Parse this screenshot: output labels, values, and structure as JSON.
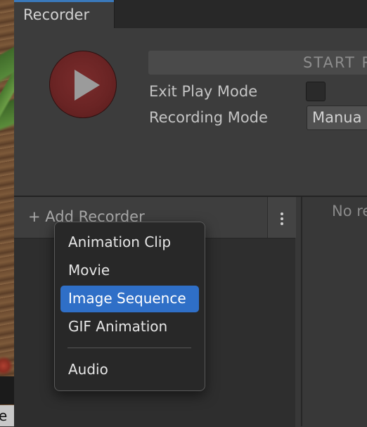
{
  "window": {
    "tab_title": "Recorder"
  },
  "controls": {
    "start_button_label": "START R",
    "exit_play_mode_label": "Exit Play Mode",
    "exit_play_mode_checked": false,
    "recording_mode_label": "Recording Mode",
    "recording_mode_value": "Manua"
  },
  "recorder_list": {
    "add_recorder_label": "+ Add Recorder",
    "empty_text": "No re"
  },
  "context_menu": {
    "items": [
      {
        "label": "Animation Clip",
        "selected": false
      },
      {
        "label": "Movie",
        "selected": false
      },
      {
        "label": "Image Sequence",
        "selected": true
      },
      {
        "label": "GIF Animation",
        "selected": false
      },
      {
        "label": "Audio",
        "selected": false
      }
    ]
  },
  "scene": {
    "bottom_label": "e"
  },
  "colors": {
    "accent": "#3a79bb",
    "selection": "#2f6fc7",
    "record_button": "#6a2424",
    "background": "#383838"
  },
  "icons": {
    "record": "play-triangle-icon",
    "more": "kebab-menu-icon"
  }
}
